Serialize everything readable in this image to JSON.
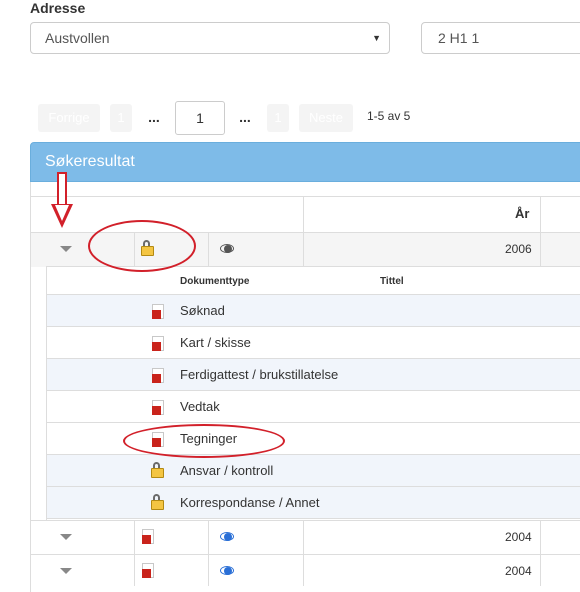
{
  "address": {
    "label": "Adresse",
    "street_value": "Austvollen",
    "number_value": "2 H1 1"
  },
  "pagination": {
    "prev_label": "Forrige",
    "first_page": "1",
    "dots": "...",
    "current_page": "1",
    "last_page": "1",
    "next_label": "Neste",
    "info": "1-5 av 5"
  },
  "results": {
    "title": "Søkeresultat",
    "year_header": "År",
    "rows": [
      {
        "year": "2006",
        "locked": true
      },
      {
        "year": "2004",
        "locked": false
      },
      {
        "year": "2004",
        "locked": false
      }
    ],
    "sub_headers": {
      "doc_type": "Dokumenttype",
      "title": "Tittel"
    },
    "documents": [
      {
        "label": "Søknad",
        "icon": "pdf-icon"
      },
      {
        "label": "Kart / skisse",
        "icon": "pdf-icon"
      },
      {
        "label": "Ferdigattest / brukstillatelse",
        "icon": "pdf-icon"
      },
      {
        "label": "Vedtak",
        "icon": "pdf-icon"
      },
      {
        "label": "Tegninger",
        "icon": "pdf-icon"
      },
      {
        "label": "Ansvar / kontroll",
        "icon": "lock-icon"
      },
      {
        "label": "Korrespondanse / Annet",
        "icon": "lock-icon"
      }
    ]
  },
  "colors": {
    "panel_header": "#7ebbe8",
    "annotation": "#d2202a",
    "row_alt": "#f1f5fb"
  }
}
